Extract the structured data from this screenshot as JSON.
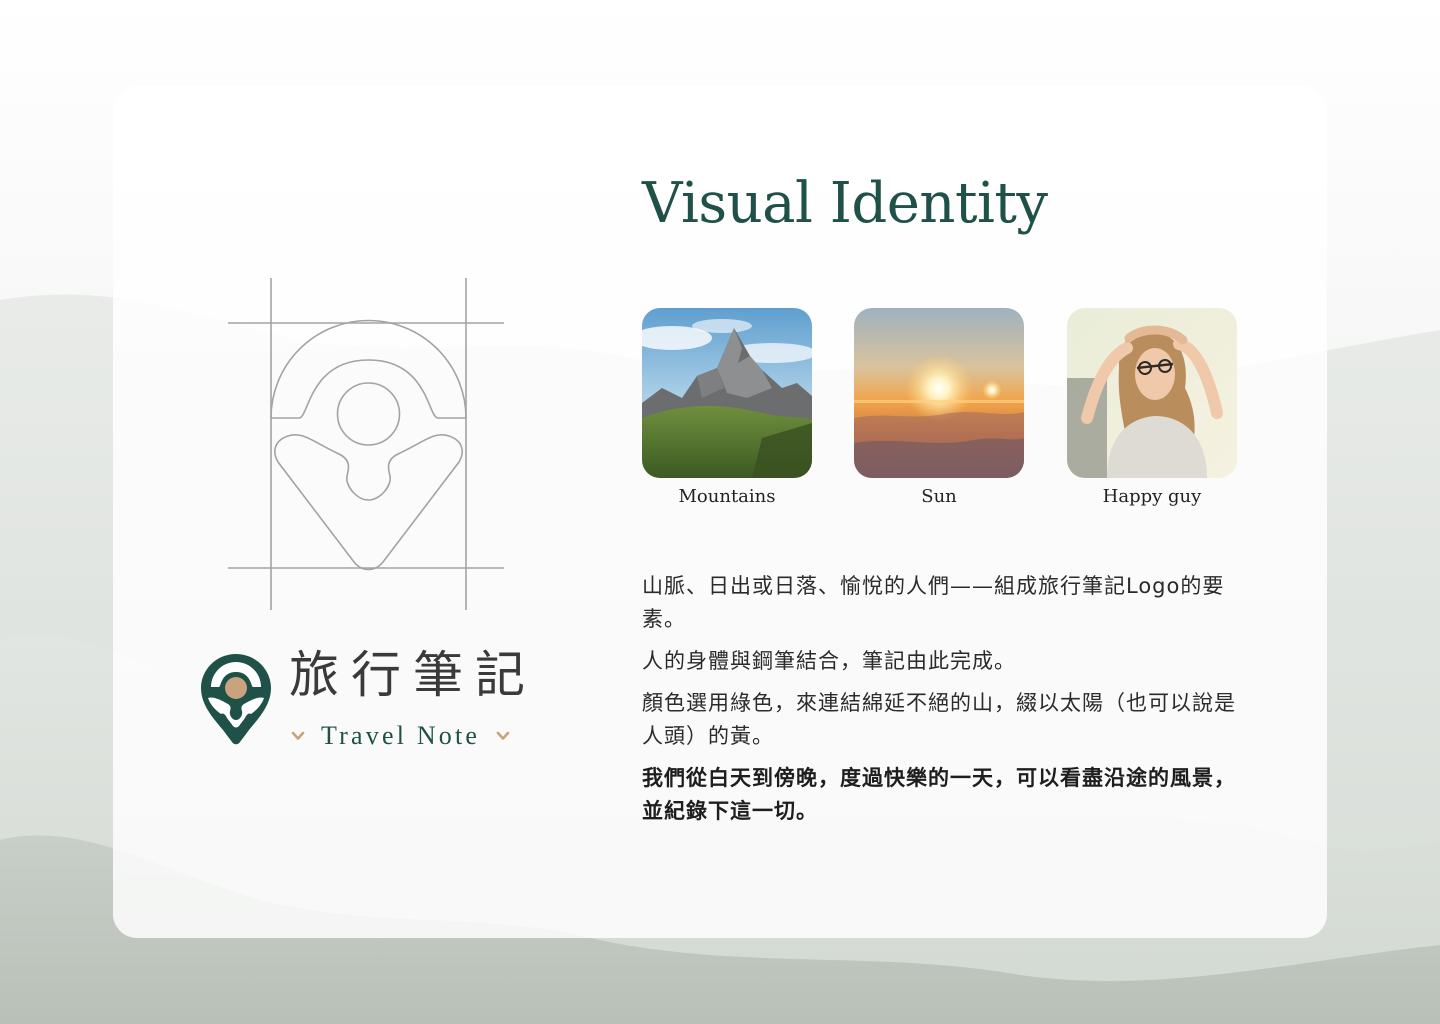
{
  "brand": {
    "name_cn": "旅行筆記",
    "name_en": "Travel Note",
    "colors": {
      "primary": "#1f5148",
      "accent": "#c9a27e",
      "outline": "#a3a3a3"
    }
  },
  "header": {
    "title": "Visual Identity"
  },
  "elements": [
    {
      "label": "Mountains",
      "icon": "mountains-photo"
    },
    {
      "label": "Sun",
      "icon": "sunset-photo"
    },
    {
      "label": "Happy guy",
      "icon": "happy-person-photo"
    }
  ],
  "description": {
    "p1": "山脈、日出或日落、愉悅的人們——組成旅行筆記Logo的要素。",
    "p2": "人的身體與鋼筆結合，筆記由此完成。",
    "p3": "顏色選用綠色，來連結綿延不絕的山，綴以太陽（也可以說是人頭）的黃。",
    "p4": "我們從白天到傍晚，度過快樂的一天，可以看盡沿途的風景，並紀錄下這一切。"
  }
}
